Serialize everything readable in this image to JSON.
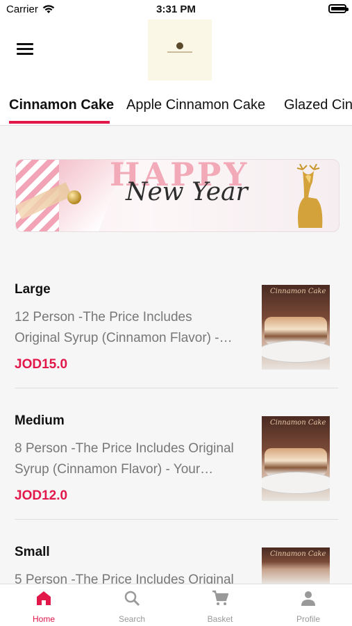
{
  "status_bar": {
    "carrier": "Carrier",
    "time": "3:31 PM",
    "battery_level": 0.9
  },
  "header": {
    "menu_icon": "menu-icon",
    "logo_name": "brand-logo"
  },
  "tabs": [
    {
      "label": "Cinnamon Cake",
      "active": true
    },
    {
      "label": "Apple Cinnamon Cake",
      "active": false
    },
    {
      "label": "Glazed Cin",
      "active": false
    }
  ],
  "banner": {
    "headline": "HAPPY",
    "script_text": "New Year"
  },
  "items": [
    {
      "name": "Large",
      "description_line1": "12 Person -The Price Includes",
      "description_line2": "Original Syrup (Cinnamon Flavor) -…",
      "price": "JOD15.0",
      "image_text": "Cinnamon Cake"
    },
    {
      "name": "Medium",
      "description_line1": "8 Person -The Price Includes Original",
      "description_line2": "Syrup (Cinnamon Flavor) - Your…",
      "price": "JOD12.0",
      "image_text": "Cinnamon Cake"
    },
    {
      "name": "Small",
      "description_line1": "5 Person -The Price Includes Original",
      "description_line2": "",
      "price": "",
      "image_text": "Cinnamon Cake"
    }
  ],
  "tab_bar": [
    {
      "label": "Home",
      "icon": "home-icon",
      "active": true
    },
    {
      "label": "Search",
      "icon": "search-icon",
      "active": false
    },
    {
      "label": "Basket",
      "icon": "cart-icon",
      "active": false
    },
    {
      "label": "Profile",
      "icon": "person-icon",
      "active": false
    }
  ],
  "colors": {
    "accent": "#e2174a",
    "background": "#f6f6f6"
  }
}
